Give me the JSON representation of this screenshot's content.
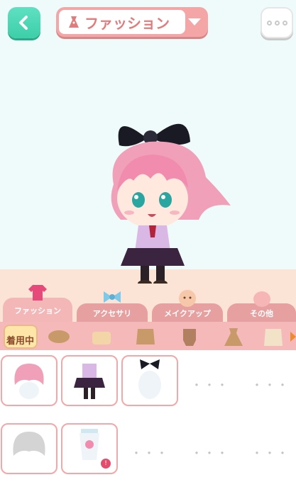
{
  "header": {
    "back_icon": "chevron-left-icon",
    "category_label": "ファッション",
    "category_icon": "dress-icon",
    "dropdown_icon": "caret-down-icon",
    "more_icon": "ellipsis-icon"
  },
  "tabs": [
    {
      "label": "ファッション",
      "icon": "clothes-icon",
      "active": true
    },
    {
      "label": "アクセサリ",
      "icon": "ribbon-icon",
      "active": false
    },
    {
      "label": "メイクアップ",
      "icon": "face-icon",
      "active": false
    },
    {
      "label": "その他",
      "icon": "other-icon",
      "active": false
    }
  ],
  "subcategories": {
    "wearing_label": "着用中",
    "items": [
      "hair-icon",
      "top-icon",
      "outfit-icon",
      "overalls-icon",
      "dress-icon",
      "coat-icon"
    ]
  },
  "items_grid": {
    "placeholder": "・・・",
    "cells": [
      {
        "name": "pink-hair-item"
      },
      {
        "name": "school-uniform-item"
      },
      {
        "name": "black-ribbon-item"
      },
      {
        "name": "empty-slot"
      },
      {
        "name": "empty-slot"
      },
      {
        "name": "white-hair-item"
      },
      {
        "name": "bottle-item"
      },
      {
        "name": "empty-slot"
      },
      {
        "name": "empty-slot"
      },
      {
        "name": "empty-slot"
      }
    ]
  },
  "colors": {
    "accent": "#f4a6a6",
    "back_button": "#3ccfa8",
    "badge": "#e54b6b"
  }
}
